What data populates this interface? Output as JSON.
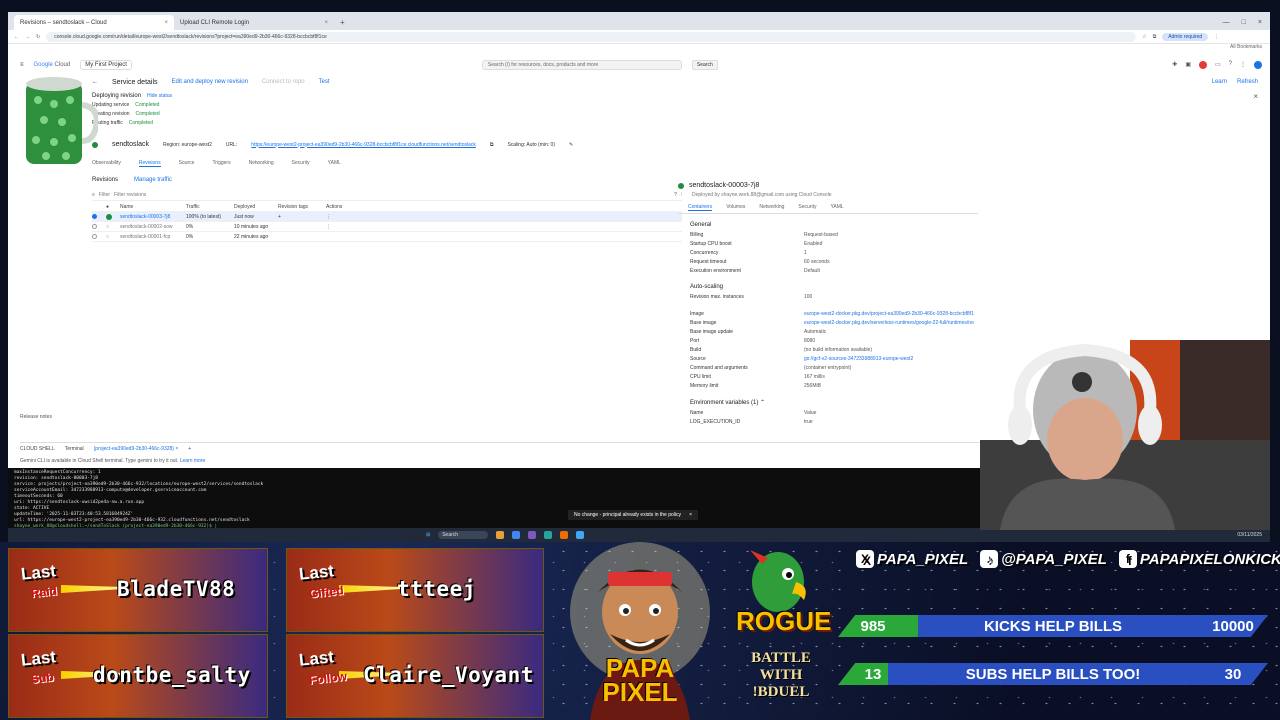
{
  "browser": {
    "tabs": [
      {
        "label": "Revisions – sendtoslack – Cloud"
      },
      {
        "label": "Upload CLI Remote Login"
      }
    ],
    "url": "console.cloud.google.com/run/detail/europe-west2/sendtoslack/revisions?project=ea390ed9-2b30-466c-9328-bccbcbf8f1ce",
    "admin_badge": "Admin required",
    "bookmarks_label": "All Bookmarks"
  },
  "console": {
    "logo_google": "Google",
    "logo_cloud": "Cloud",
    "project": "My First Project",
    "search_placeholder": "Search (/) for resources, docs, products and more",
    "search_button": "Search",
    "page_title": "Service details",
    "edit_deploy": "Edit and deploy new revision",
    "connect_repo": "Connect to repo",
    "test": "Test",
    "learn": "Learn",
    "refresh": "Refresh",
    "deploying": {
      "title": "Deploying revision",
      "hide": "Hide status",
      "steps": [
        {
          "name": "Updating service",
          "status": "Completed"
        },
        {
          "name": "Creating revision",
          "status": "Completed"
        },
        {
          "name": "Routing traffic",
          "status": "Completed"
        }
      ]
    },
    "service": {
      "name": "sendtoslack",
      "region": "Region: europe-west2",
      "url_label": "URL:",
      "url": "https://europe-west2-project-ea390ed9-2b30-466c-9328-bccbcbf8f1ce.cloudfunctions.net/sendtoslack",
      "scaling": "Scaling: Auto (min: 0)"
    },
    "tabs": [
      "Observability",
      "Revisions",
      "Source",
      "Triggers",
      "Networking",
      "Security",
      "YAML"
    ],
    "revisions_title": "Revisions",
    "manage_traffic": "Manage traffic",
    "filter_label": "Filter",
    "filter_placeholder": "Filter revisions",
    "table": {
      "headers": [
        "Name",
        "Traffic",
        "Deployed",
        "Revision tags",
        "Actions"
      ],
      "rows": [
        {
          "name": "sendtoslack-00003-7j8",
          "traffic": "100% (to latest)",
          "deployed": "Just now",
          "tag": "+"
        },
        {
          "name": "sendtoslack-00002-sow",
          "traffic": "0%",
          "deployed": "10 minutes ago",
          "tag": ""
        },
        {
          "name": "sendtoslack-00001-fcp",
          "traffic": "0%",
          "deployed": "22 minutes ago",
          "tag": ""
        }
      ]
    },
    "detail": {
      "title": "sendtoslack-00003-7j8",
      "subtitle": "Deployed by shayne.work.88@gmail.com using Cloud Console",
      "tabs": [
        "Containers",
        "Volumes",
        "Networking",
        "Security",
        "YAML"
      ],
      "general_title": "General",
      "general": [
        {
          "k": "Billing",
          "v": "Request-based"
        },
        {
          "k": "Startup CPU boost",
          "v": "Enabled"
        },
        {
          "k": "Concurrency",
          "v": "1"
        },
        {
          "k": "Request timeout",
          "v": "60 seconds"
        },
        {
          "k": "Execution environment",
          "v": "Default"
        }
      ],
      "autoscaling_title": "Auto-scaling",
      "autoscaling": [
        {
          "k": "Revision max. instances",
          "v": "100"
        }
      ],
      "container": [
        {
          "k": "Image",
          "v": "europe-west2-docker.pkg.dev/project-ea390ed9-2b30-466c-9328-bccbcbf8f1ce/gcf-artifacts"
        },
        {
          "k": "Base image",
          "v": "europe-west2-docker.pkg.dev/serverless-runtimes/google-22-full/runtimes/nodejs22"
        },
        {
          "k": "Base image update",
          "v": "Automatic"
        },
        {
          "k": "Port",
          "v": "8080"
        },
        {
          "k": "Build",
          "v": "(no build information available)"
        },
        {
          "k": "Source",
          "v": "gs://gcf-v2-sources-347233988913-europe-west2"
        },
        {
          "k": "Command and arguments",
          "v": "(container entrypoint)"
        },
        {
          "k": "CPU limit",
          "v": "167 millis"
        },
        {
          "k": "Memory limit",
          "v": "256MiB"
        }
      ],
      "env_title": "Environment variables (1)",
      "env_headers": [
        "Name",
        "Value"
      ],
      "env_row": [
        "LOG_EXECUTION_ID",
        "true"
      ]
    },
    "release_notes": "Release notes"
  },
  "cloudshell": {
    "label": "CLOUD SHELL",
    "terminal_tab": "Terminal",
    "session_tab": "(project-ea390ed9-2b30-466c-9328) ×",
    "info": "Gemini CLI is available in Cloud Shell terminal. Type gemini to try it out.",
    "info_link": "Learn more",
    "lines": [
      "maxInstanceRequestConcurrency: 1",
      "revision: sendtoslack-00003-7j8",
      "service: projects/project-ea390ed9-2b30-466c-932/locations/europe-west2/services/sendtoslack",
      "serviceAccountEmail: 347233988913-compute@developer.gserviceaccount.com",
      "timeoutSeconds: 60",
      "uri: https://sendtoslack-uwsid2pe4a-nw.a.run.app",
      "state: ACTIVE",
      "updateTime: '2025-11-03T23:40:53.581684924Z'",
      "url: https://europe-west2-project-ea390ed9-2b30-466c-932.cloudfunctions.net/sendtoslack",
      "shayne_work_88@cloudshell:~/sendToSlack (project-ea390ed9-2b30-466c-932)$ |"
    ],
    "toast": "No change - principal already exists in the policy",
    "taskbar_search": "Search",
    "clock": "03/11/2025"
  },
  "overlay": {
    "events": [
      {
        "line1": "Last",
        "line2": "Raid",
        "name": "BladeTV88"
      },
      {
        "line1": "Last",
        "line2": "Gifted",
        "name": "ttteej"
      },
      {
        "line1": "Last",
        "line2": "Sub",
        "name": "dontbe_salty"
      },
      {
        "line1": "Last",
        "line2": "Follow",
        "name": "Claire_Voyant"
      }
    ],
    "brand": "PAPA PIXEL",
    "rogue": "ROGUE",
    "battle": [
      "BATTLE",
      "WITH",
      "!BDUEL"
    ],
    "socials": [
      {
        "icon": "X",
        "handle": "PAPA_PIXEL"
      },
      {
        "icon": "♪",
        "handle": "@PAPA_PIXEL"
      },
      {
        "icon": "f",
        "handle": "PAPAPIXELONKICK"
      }
    ],
    "goals": [
      {
        "current": "985",
        "label": "KICKS HELP BILLS",
        "target": "10000"
      },
      {
        "current": "13",
        "label": "SUBS HELP BILLS TOO!",
        "target": "30"
      }
    ],
    "colors": {
      "goal_fill": "#2aa83a",
      "goal_bg": "#2a4fc0",
      "gcp_blue": "#1a73e8",
      "ok_green": "#1e8e3e"
    }
  }
}
